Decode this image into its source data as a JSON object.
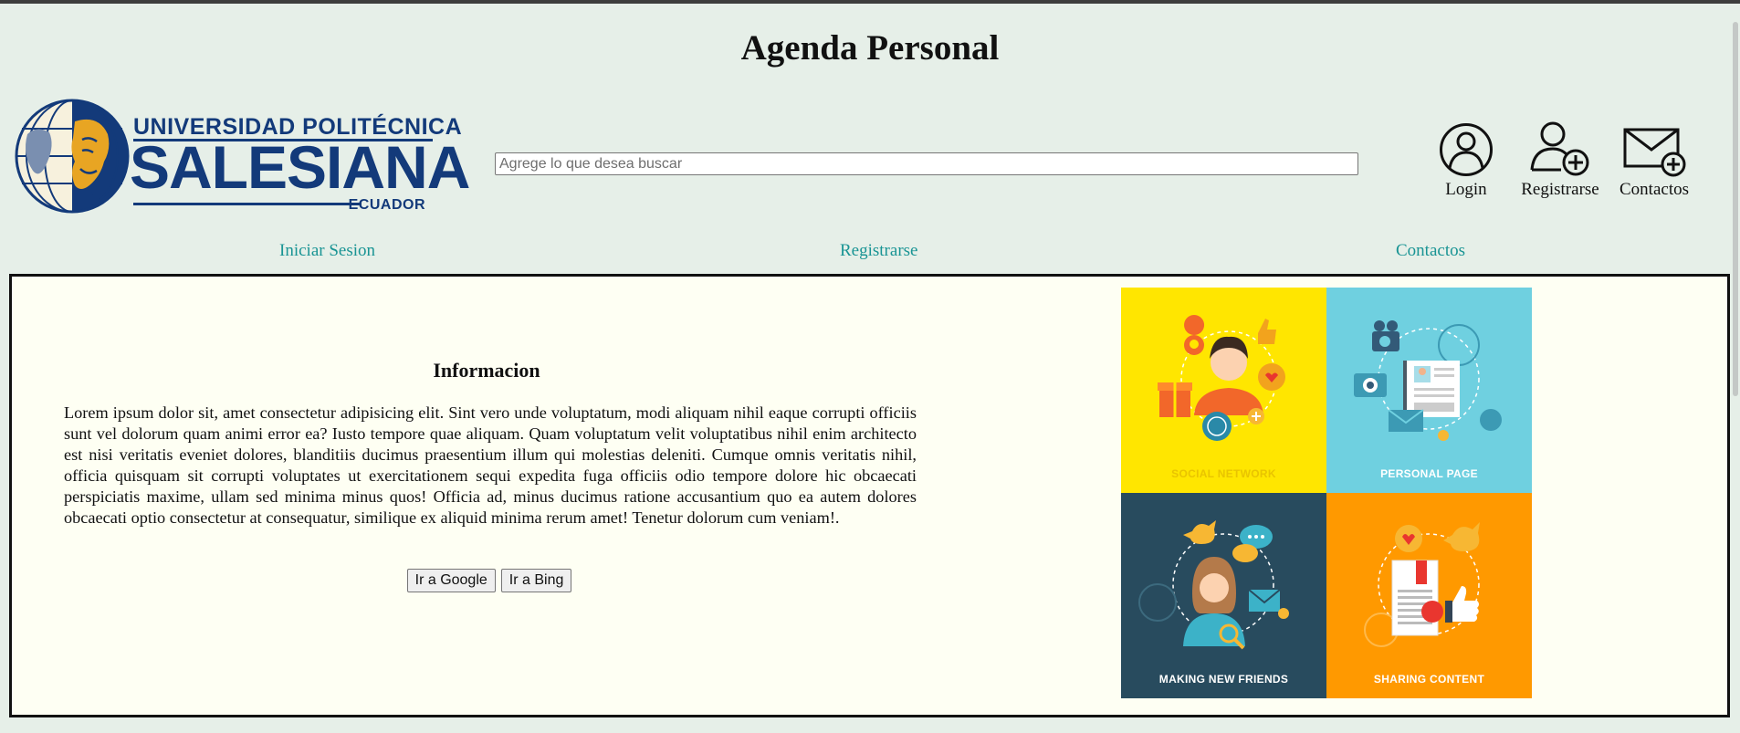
{
  "page": {
    "title": "Agenda Personal"
  },
  "logo": {
    "line1": "UNIVERSIDAD POLITÉCNICA",
    "line2": "SALESIANA",
    "line3": "ECUADOR"
  },
  "search": {
    "placeholder": "Agrege lo que desea buscar",
    "value": ""
  },
  "header_icons": {
    "login": {
      "label": "Login",
      "icon": "user-circle-icon"
    },
    "register": {
      "label": "Registrarse",
      "icon": "user-add-icon"
    },
    "contacts": {
      "label": "Contactos",
      "icon": "envelope-add-icon"
    }
  },
  "nav": {
    "items": [
      {
        "label": "Iniciar Sesion"
      },
      {
        "label": "Registrarse"
      },
      {
        "label": "Contactos"
      }
    ],
    "link_color": "#199494"
  },
  "info": {
    "heading": "Informacion",
    "body": "Lorem ipsum dolor sit, amet consectetur adipisicing elit. Sint vero unde voluptatum, modi aliquam nihil eaque corrupti officiis sunt vel dolorum quam animi error ea? Iusto tempore quae aliquam. Quam voluptatum velit voluptatibus nihil enim architecto est nisi veritatis eveniet dolores, blanditiis ducimus praesentium illum qui molestias deleniti. Cumque omnis veritatis nihil, officia quisquam sit corrupti voluptates ut exercitationem sequi expedita fuga officiis odio tempore dolore hic obcaecati perspiciatis maxime, ullam sed minima minus quos! Officia ad, minus ducimus ratione accusantium quo ea autem dolores obcaecati optio consectetur at consequatur, similique ex aliquid minima rerum amet! Tenetur dolorum cum veniam!.",
    "buttons": {
      "google": "Ir a Google",
      "bing": "Ir a Bing"
    }
  },
  "image_grid": {
    "tiles": [
      {
        "label": "SOCIAL NETWORK",
        "color": "#ffe600"
      },
      {
        "label": "PERSONAL PAGE",
        "color": "#6fd0e0"
      },
      {
        "label": "MAKING NEW FRIENDS",
        "color": "#284b5e"
      },
      {
        "label": "SHARING CONTENT",
        "color": "#ff9900"
      }
    ]
  },
  "colors": {
    "page_background": "#e6efe8",
    "main_background": "#fefff3",
    "logo_blue": "#133a7a",
    "logo_gold": "#e8a523"
  }
}
